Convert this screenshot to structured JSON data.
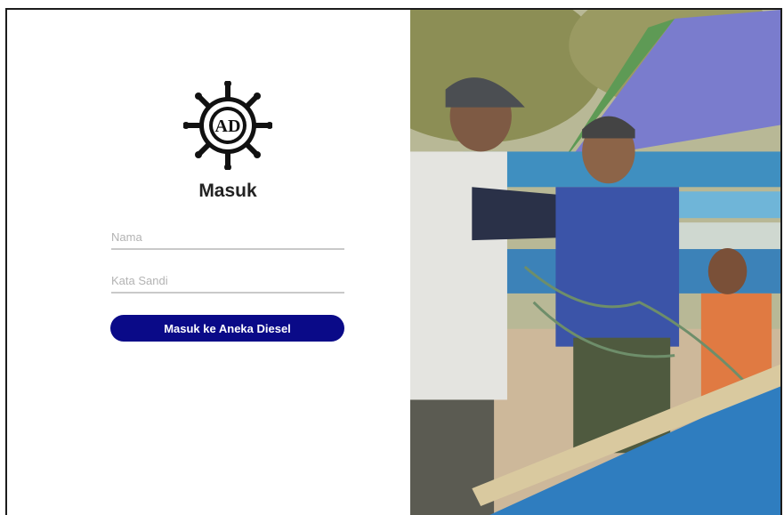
{
  "login": {
    "heading": "Masuk",
    "username_placeholder": "Nama",
    "password_placeholder": "Kata Sandi",
    "submit_label": "Masuk ke Aneka Diesel",
    "logo_letters": "AD"
  },
  "hero_image": {
    "subject": "fishermen mending nets on a boat"
  },
  "colors": {
    "primary": "#0a0a88",
    "text": "#222222"
  },
  "icons": [
    "ship-wheel-logo-icon"
  ]
}
